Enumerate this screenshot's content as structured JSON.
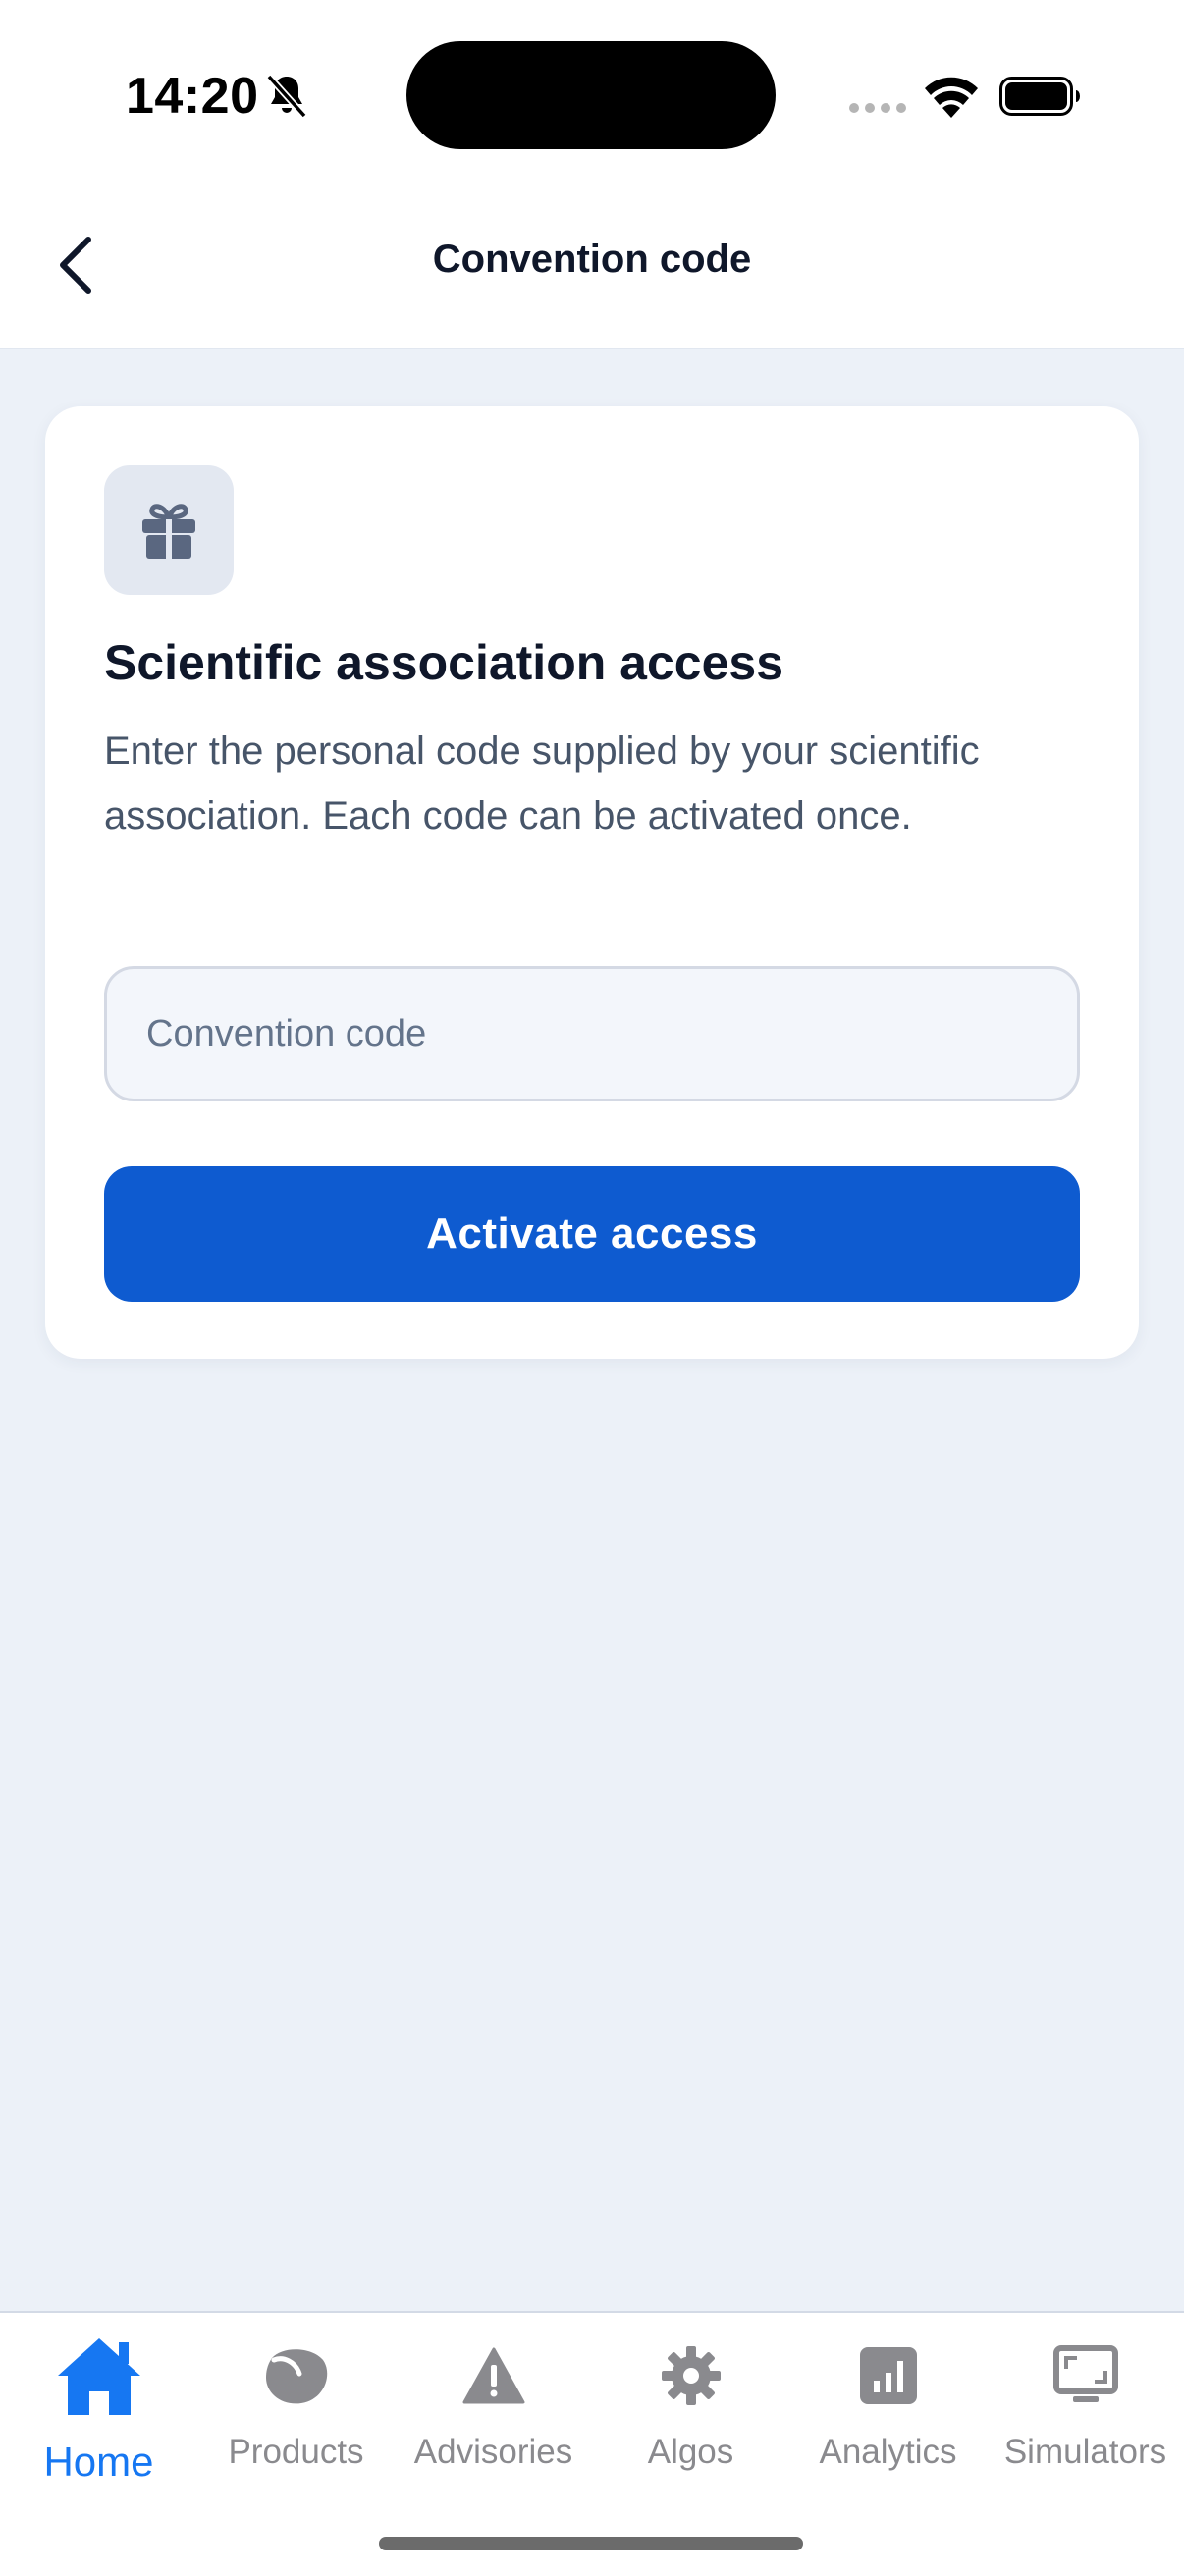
{
  "status_bar": {
    "time": "14:20"
  },
  "header": {
    "title": "Convention code",
    "back_icon": "chevron-left-icon"
  },
  "card": {
    "icon": "gift-icon",
    "title": "Scientific association access",
    "description": "Enter the personal code supplied by your scientific association. Each code can be activated once.",
    "input_placeholder": "Convention code",
    "input_value": "",
    "button_label": "Activate access"
  },
  "tab_bar": {
    "items": [
      {
        "label": "Home",
        "icon": "home-icon",
        "active": true
      },
      {
        "label": "Products",
        "icon": "products-icon",
        "active": false
      },
      {
        "label": "Advisories",
        "icon": "warning-icon",
        "active": false
      },
      {
        "label": "Algos",
        "icon": "gear-icon",
        "active": false
      },
      {
        "label": "Analytics",
        "icon": "chart-icon",
        "active": false
      },
      {
        "label": "Simulators",
        "icon": "monitor-icon",
        "active": false
      }
    ]
  },
  "colors": {
    "accent": "#0e5bd0",
    "tab_active": "#1677f2",
    "tab_inactive": "#8a8a8e",
    "background": "#ecf1f8"
  }
}
